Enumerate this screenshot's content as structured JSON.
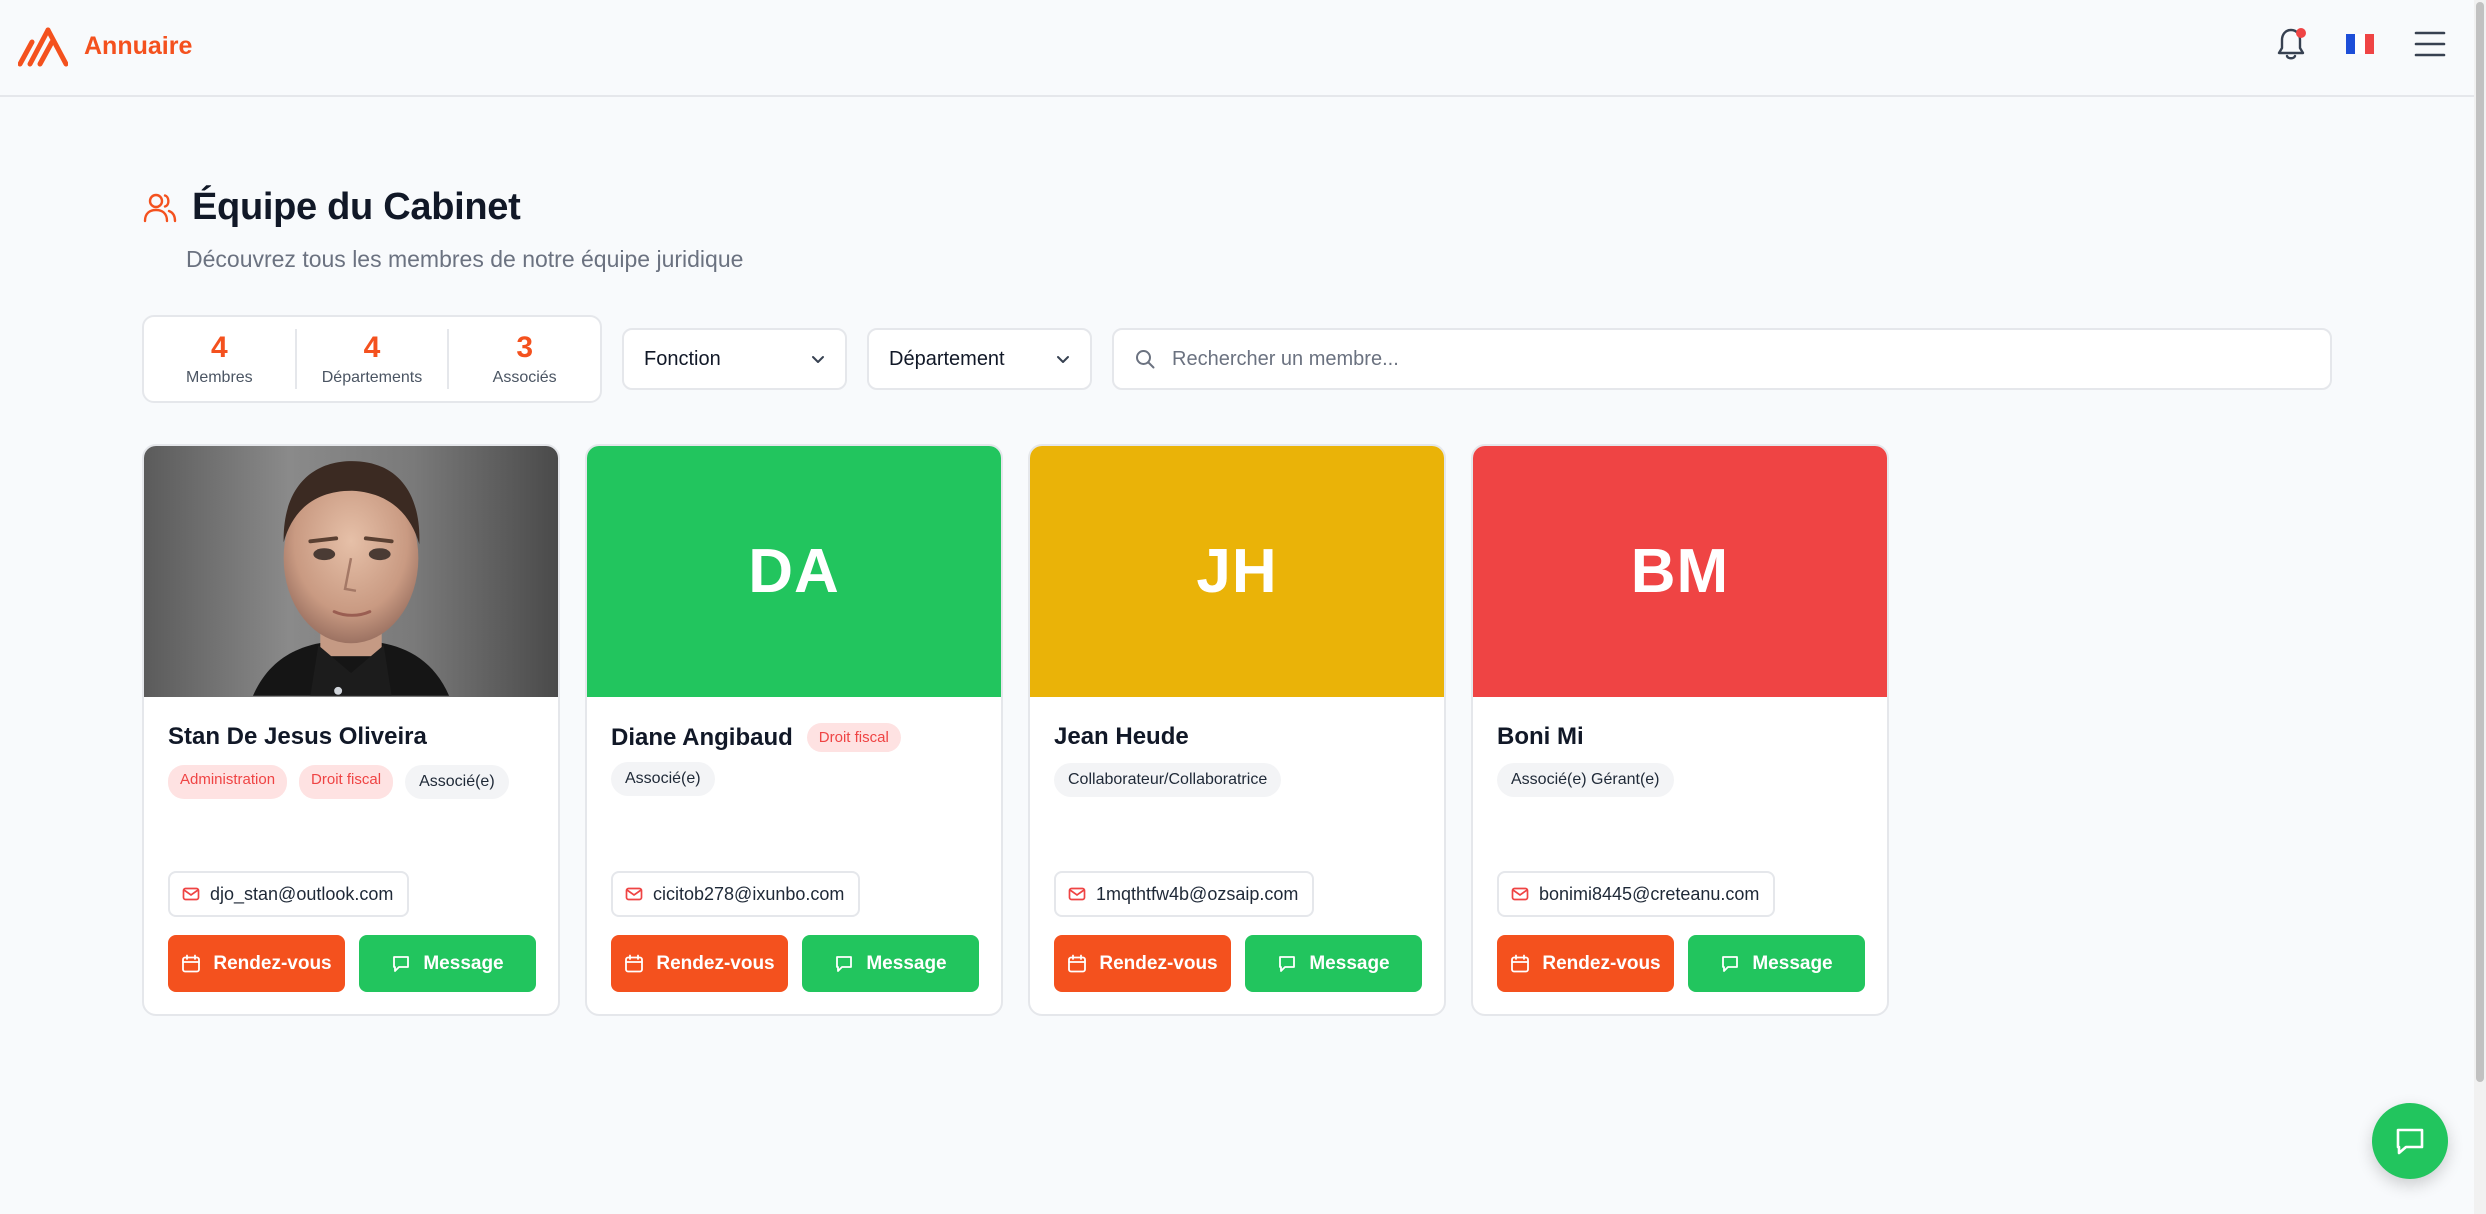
{
  "header": {
    "brand": "Annuaire",
    "notification_icon": "bell-icon",
    "language_flag": "france-flag-icon",
    "menu_icon": "hamburger-menu-icon"
  },
  "colors": {
    "accent": "#f4511e",
    "green": "#22c55e",
    "yellow": "#eab308",
    "red": "#ef4444"
  },
  "page": {
    "title": "Équipe du Cabinet",
    "subtitle": "Découvrez tous les membres de notre équipe juridique"
  },
  "stats": [
    {
      "value": "4",
      "label": "Membres"
    },
    {
      "value": "4",
      "label": "Départements"
    },
    {
      "value": "3",
      "label": "Associés"
    }
  ],
  "filters": {
    "fonction": "Fonction",
    "departement": "Département",
    "search_placeholder": "Rechercher un membre..."
  },
  "buttons": {
    "appointment": "Rendez-vous",
    "message": "Message"
  },
  "members": [
    {
      "name": "Stan De Jesus Oliveira",
      "departments": [
        "Administration",
        "Droit fiscal"
      ],
      "role": "Associé(e)",
      "email": "djo_stan@outlook.com",
      "avatar": "photo"
    },
    {
      "name": "Diane Angibaud",
      "initials": "DA",
      "departments": [
        "Droit fiscal"
      ],
      "role": "Associé(e)",
      "email": "cicitob278@ixunbo.com",
      "color": "#22c55e"
    },
    {
      "name": "Jean Heude",
      "initials": "JH",
      "departments": [],
      "role": "Collaborateur/Collaboratrice",
      "email": "1mqthtfw4b@ozsaip.com",
      "color": "#eab308"
    },
    {
      "name": "Boni Mi",
      "initials": "BM",
      "departments": [],
      "role": "Associé(e) Gérant(e)",
      "email": "bonimi8445@creteanu.com",
      "color": "#ef4444"
    }
  ],
  "chat_icon": "chat-bubble-icon"
}
